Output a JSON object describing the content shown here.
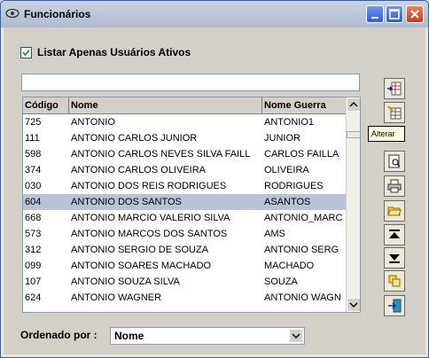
{
  "window": {
    "title": "Funcionários"
  },
  "filter": {
    "active_only_label": "Listar Apenas Usuários Ativos",
    "active_only_checked": true
  },
  "search": {
    "value": ""
  },
  "grid": {
    "columns": [
      "Código",
      "Nome",
      "Nome Guerra"
    ],
    "rows": [
      {
        "codigo": "725",
        "nome": "ANTONIO",
        "guerra": "ANTONIO1"
      },
      {
        "codigo": "111",
        "nome": "ANTONIO CARLOS JUNIOR",
        "guerra": "JUNIOR"
      },
      {
        "codigo": "598",
        "nome": "ANTONIO CARLOS NEVES SILVA FAILL",
        "guerra": "CARLOS FAILLA"
      },
      {
        "codigo": "374",
        "nome": "ANTONIO CARLOS OLIVEIRA",
        "guerra": "OLIVEIRA"
      },
      {
        "codigo": "030",
        "nome": "ANTONIO DOS REIS RODRIGUES",
        "guerra": "RODRIGUES"
      },
      {
        "codigo": "604",
        "nome": "ANTONIO DOS SANTOS",
        "guerra": "ASANTOS"
      },
      {
        "codigo": "668",
        "nome": "ANTONIO MARCIO VALERIO SILVA",
        "guerra": "ANTONIO_MARC"
      },
      {
        "codigo": "573",
        "nome": "ANTONIO MARCOS DOS SANTOS",
        "guerra": "AMS"
      },
      {
        "codigo": "312",
        "nome": "ANTONIO SERGIO DE SOUZA",
        "guerra": "ANTONIO SERG"
      },
      {
        "codigo": "099",
        "nome": "ANTONIO SOARES MACHADO",
        "guerra": "MACHADO"
      },
      {
        "codigo": "107",
        "nome": "ANTONIO SOUZA SILVA",
        "guerra": "SOUZA"
      },
      {
        "codigo": "624",
        "nome": "ANTONIO WAGNER",
        "guerra": "ANTONIO WAGN"
      }
    ],
    "selected_codigo": "604"
  },
  "toolbar": {
    "tooltip": "Alterar",
    "icons": [
      "insert-row-icon",
      "edit-row-icon",
      "preview-icon",
      "print-icon",
      "open-folder-icon",
      "move-first-icon",
      "move-last-icon",
      "copy-icon",
      "exit-icon"
    ]
  },
  "order": {
    "label": "Ordenado por :",
    "value": "Nome"
  },
  "colors": {
    "selection": "#b8c3d5",
    "tooltip_bg": "#ffffe1",
    "panel": "#d4d0c8"
  }
}
